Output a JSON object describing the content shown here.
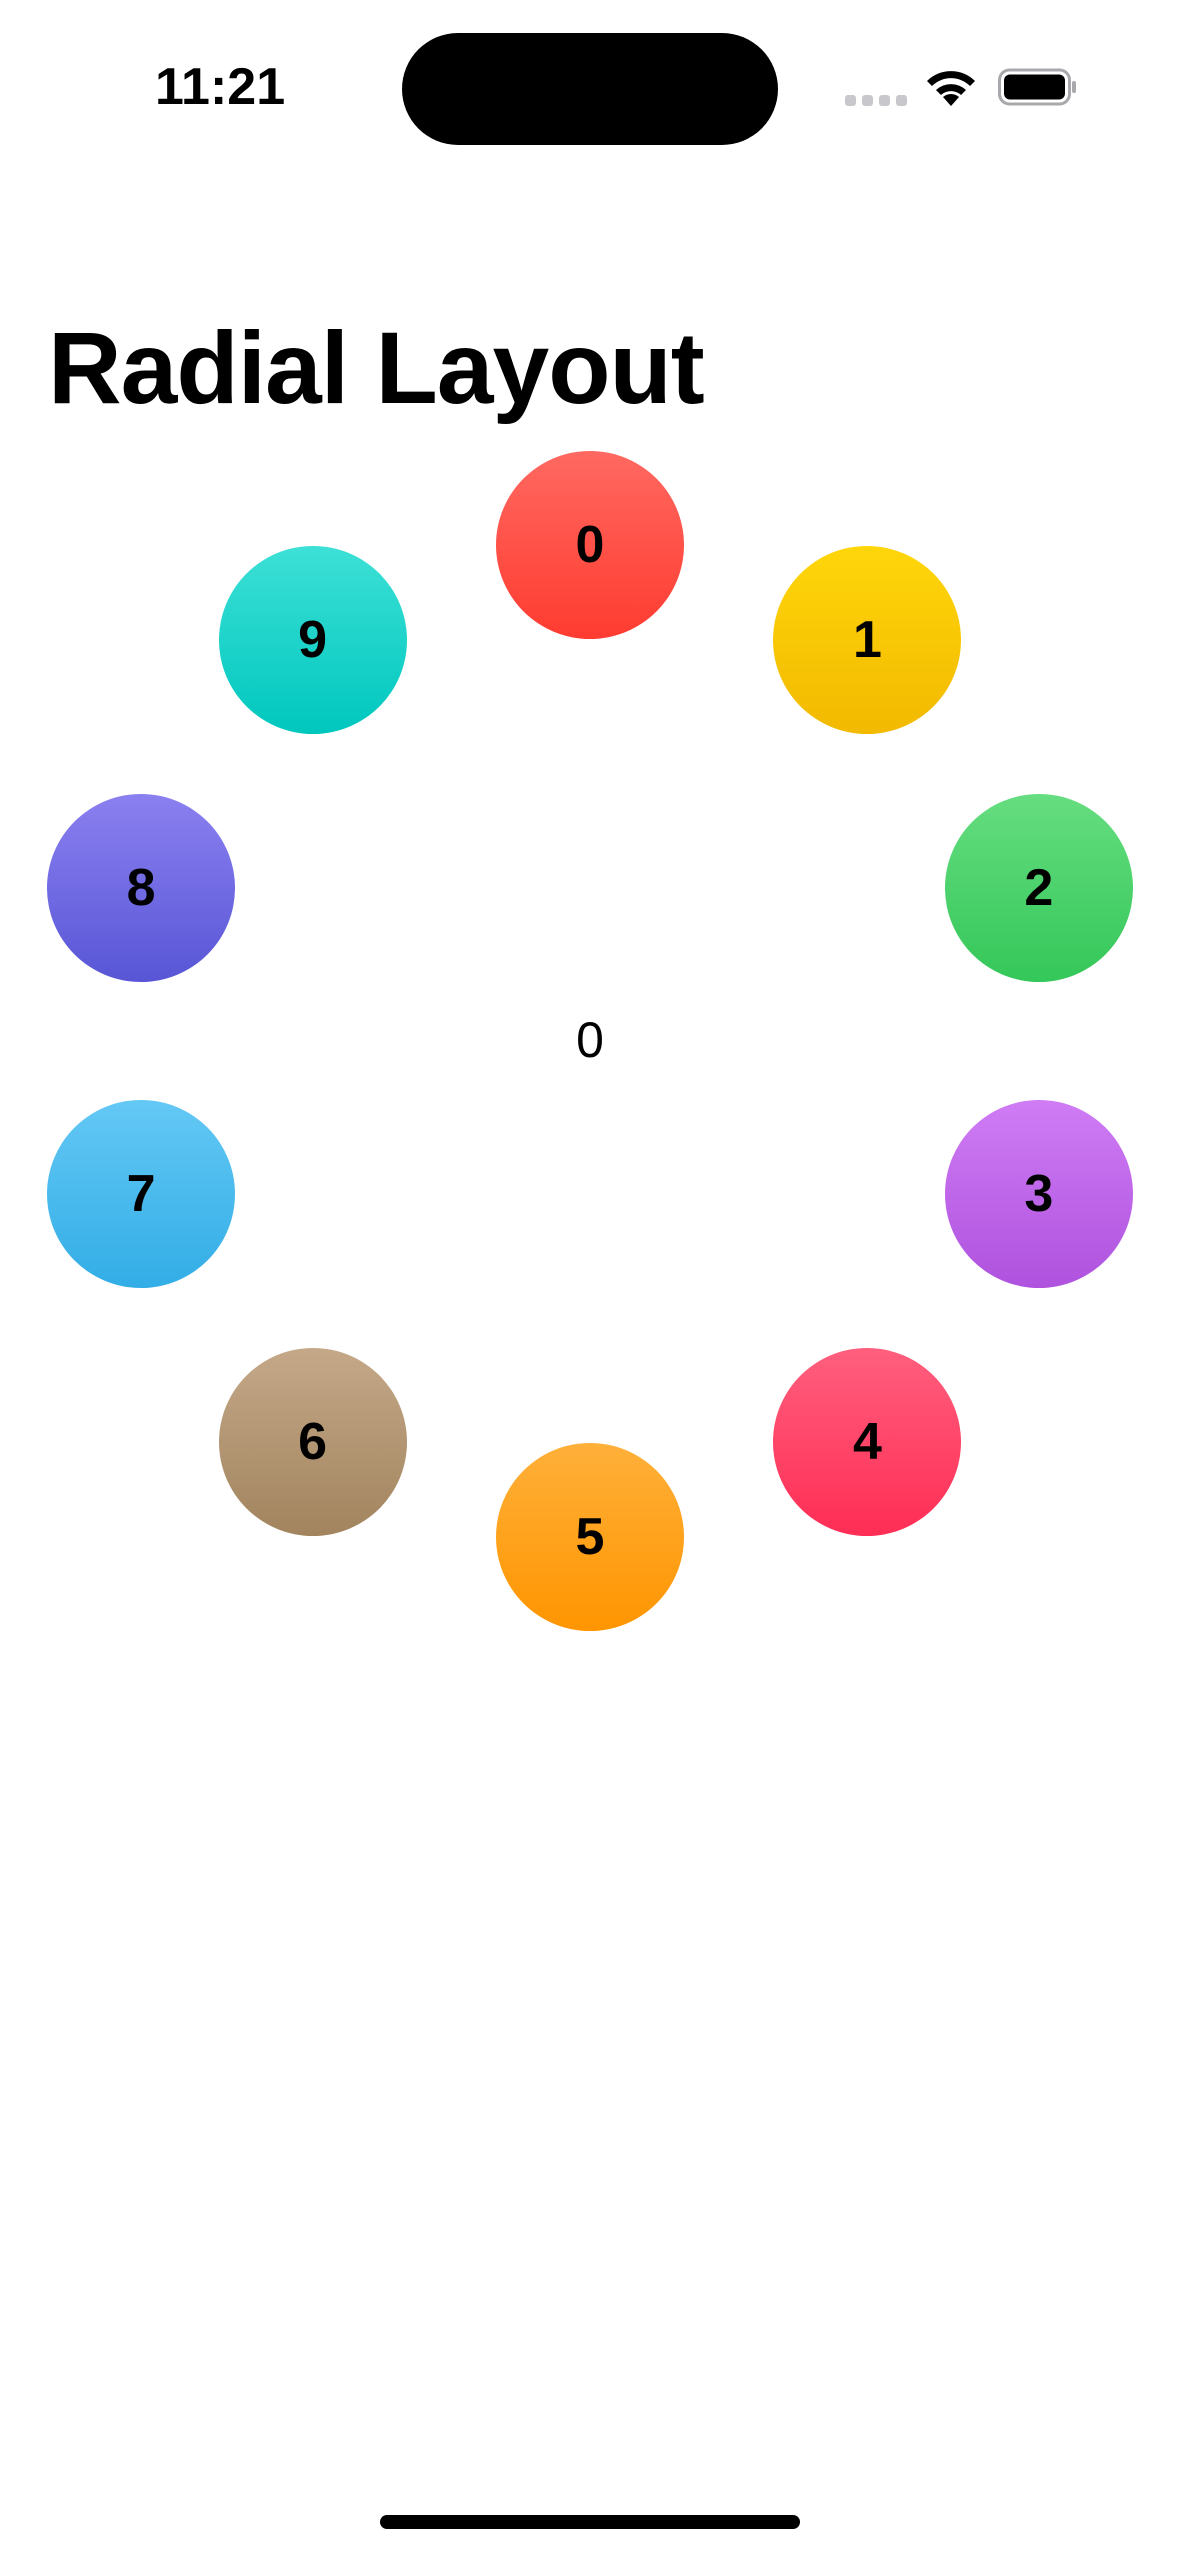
{
  "status_bar": {
    "time": "11:21",
    "icons": [
      "signal-icon",
      "wifi-icon",
      "battery-icon"
    ]
  },
  "page": {
    "title": "Radial Layout"
  },
  "radial": {
    "center_value": "0",
    "items": [
      {
        "label": "0",
        "color_top": "#ff6961",
        "color_bottom": "#ff3b30"
      },
      {
        "label": "1",
        "color_top": "#ffd60a",
        "color_bottom": "#f2b900"
      },
      {
        "label": "2",
        "color_top": "#66dd80",
        "color_bottom": "#34c759"
      },
      {
        "label": "3",
        "color_top": "#cf7cf5",
        "color_bottom": "#af52de"
      },
      {
        "label": "4",
        "color_top": "#ff5f7e",
        "color_bottom": "#ff2d55"
      },
      {
        "label": "5",
        "color_top": "#ffb03a",
        "color_bottom": "#ff9500"
      },
      {
        "label": "6",
        "color_top": "#c4a888",
        "color_bottom": "#a2845e"
      },
      {
        "label": "7",
        "color_top": "#64c8f5",
        "color_bottom": "#32ade6"
      },
      {
        "label": "8",
        "color_top": "#8b80f0",
        "color_bottom": "#5856d6"
      },
      {
        "label": "9",
        "color_top": "#3de0d6",
        "color_bottom": "#00c7be"
      }
    ]
  }
}
